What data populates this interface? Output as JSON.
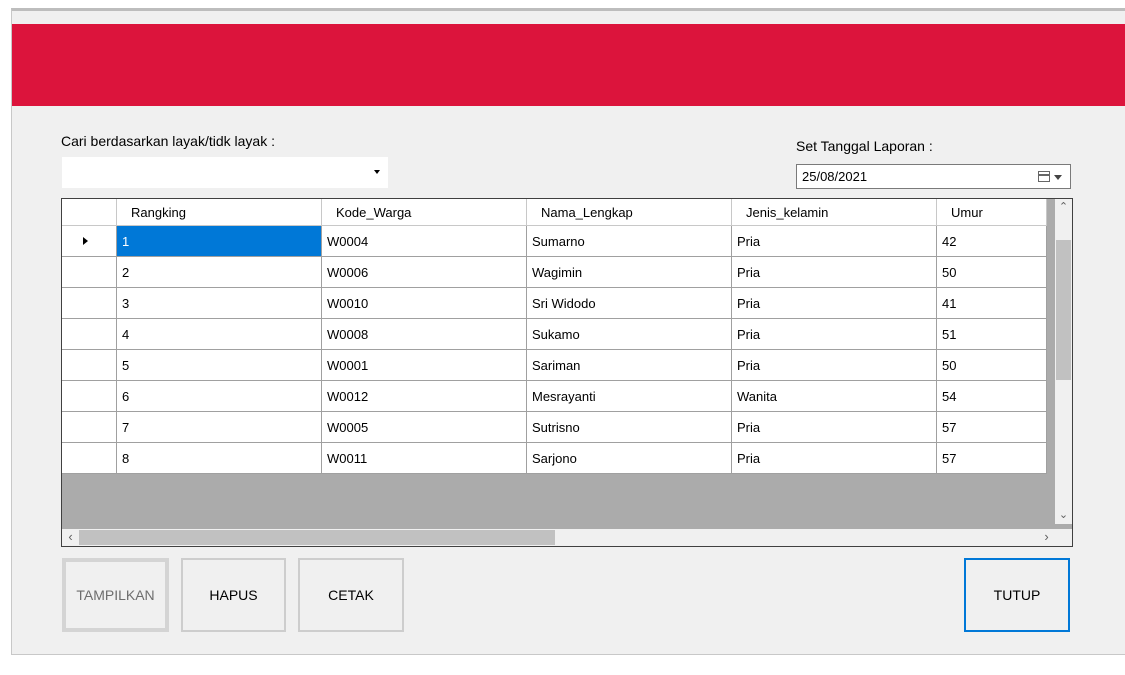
{
  "search": {
    "label": "Cari berdasarkan layak/tidk layak :",
    "value": ""
  },
  "report_date": {
    "label": "Set Tanggal Laporan :",
    "value": "25/08/2021"
  },
  "table": {
    "columns": [
      "Rangking",
      "Kode_Warga",
      "Nama_Lengkap",
      "Jenis_kelamin",
      "Umur"
    ],
    "rows": [
      [
        "1",
        "W0004",
        "Sumarno",
        "Pria",
        "42"
      ],
      [
        "2",
        "W0006",
        "Wagimin",
        "Pria",
        "50"
      ],
      [
        "3",
        "W0010",
        "Sri Widodo",
        "Pria",
        "41"
      ],
      [
        "4",
        "W0008",
        "Sukamo",
        "Pria",
        "51"
      ],
      [
        "5",
        "W0001",
        "Sariman",
        "Pria",
        "50"
      ],
      [
        "6",
        "W0012",
        "Mesrayanti",
        "Wanita",
        "54"
      ],
      [
        "7",
        "W0005",
        "Sutrisno",
        "Pria",
        "57"
      ],
      [
        "8",
        "W0011",
        "Sarjono",
        "Pria",
        "57"
      ]
    ],
    "selected_row": 0
  },
  "buttons": {
    "tampilkan": "TAMPILKAN",
    "hapus": "HAPUS",
    "cetak": "CETAK",
    "tutup": "TUTUP"
  },
  "colors": {
    "banner": "#dc143c",
    "selection": "#0078d7"
  },
  "icons": [
    "dropdown-arrow-icon",
    "calendar-icon",
    "row-pointer-icon",
    "scroll-up-icon",
    "scroll-down-icon",
    "scroll-left-icon",
    "scroll-right-icon"
  ]
}
